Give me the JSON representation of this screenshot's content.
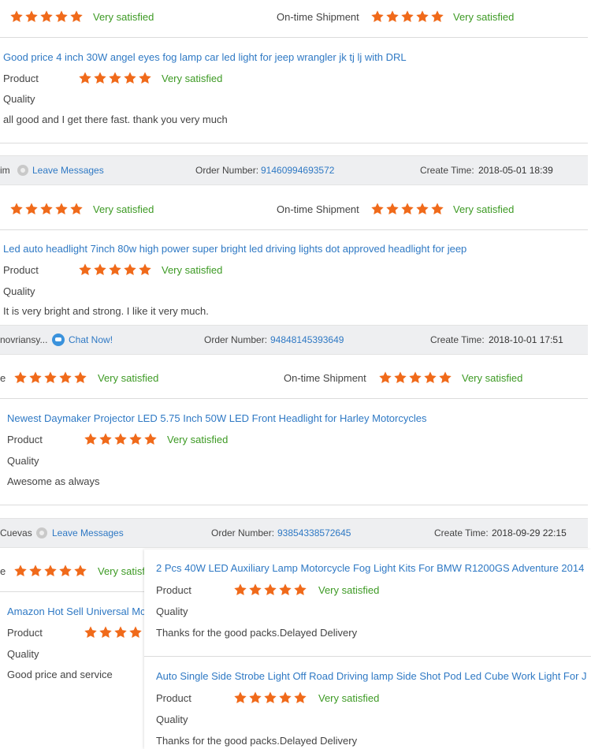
{
  "colors": {
    "star": "#f06a1a",
    "satisfied": "#3d9a24",
    "link": "#2f79c4"
  },
  "labels": {
    "very_satisfied": "Very satisfied",
    "on_time": "On-time Shipment",
    "product": "Product",
    "quality": "Quality",
    "order_number": "Order Number:",
    "create_time": "Create Time:",
    "leave_messages": "Leave Messages",
    "chat_now": "Chat Now!"
  },
  "reviews": [
    {
      "product_title": "Good price 4 inch 30W angel eyes fog lamp car led light for jeep wrangler jk tj lj with DRL",
      "comment": "all good and I get there fast. thank you very much"
    },
    {
      "buyer": "im",
      "order_number": "91460994693572",
      "create_time": "2018-05-01 18:39",
      "product_title": "Led auto headlight 7inch 80w high power super bright led driving lights dot approved headlight for jeep",
      "comment": "It is very bright and strong. I like it very much."
    },
    {
      "buyer": "novriansy...",
      "order_number": "94848145393649",
      "create_time": "2018-10-01 17:51",
      "product_title": "Newest Daymaker Projector LED 5.75 Inch 50W LED Front Headlight for Harley Motorcycles",
      "comment": "Awesome as always",
      "truncated_label": "e"
    },
    {
      "buyer": "Cuevas",
      "order_number": "93854338572645",
      "create_time": "2018-09-29 22:15",
      "truncated_label": "e",
      "truncated_satisfied": "Very satisf",
      "product_title": "Amazon Hot Sell Universal Mc",
      "comment": "Good price and service"
    }
  ],
  "overlay": [
    {
      "product_title": "2 Pcs 40W LED Auxiliary Lamp Motorcycle Fog Light Kits For BMW R1200GS Adventure 2014",
      "comment": "Thanks for the good packs.Delayed Delivery"
    },
    {
      "product_title": "Auto Single Side Strobe Light Off Road Driving lamp Side Shot Pod Led Cube Work Light For J",
      "comment": "Thanks for the good packs.Delayed Delivery"
    }
  ]
}
